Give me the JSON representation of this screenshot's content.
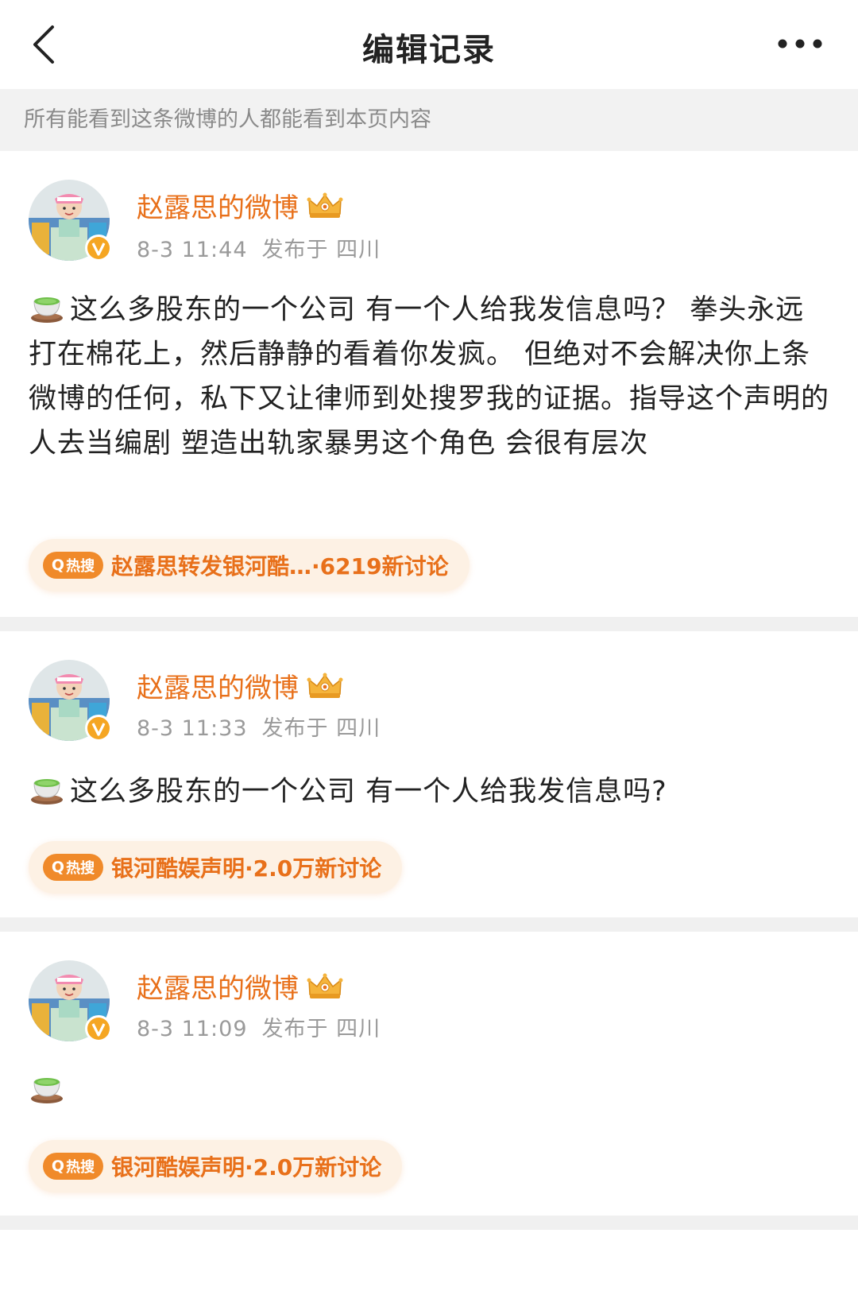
{
  "navbar": {
    "back_icon": "chevron-left-icon",
    "title": "编辑记录",
    "more_icon": "more-horizontal-icon"
  },
  "notice": "所有能看到这条微博的人都能看到本页内容",
  "accent_color": "#e8701a",
  "entries": [
    {
      "username": "赵露思的微博",
      "time": "8-3 11:44",
      "location": "发布于 四川",
      "emoji": "tea-icon",
      "text": "这么多股东的一个公司 有一个人给我发信息吗？ 拳头永远打在棉花上，然后静静的看着你发疯。 但绝对不会解决你上条微博的任何，私下又让律师到处搜罗我的证据。指导这个声明的人去当编剧 塑造出轨家暴男这个角色 会很有层次",
      "hot_badge": "热搜",
      "hot_topic": "赵露思转发银河酷…",
      "hot_count": " ·6219新讨论"
    },
    {
      "username": "赵露思的微博",
      "time": "8-3 11:33",
      "location": "发布于 四川",
      "emoji": "tea-icon",
      "text": "这么多股东的一个公司 有一个人给我发信息吗?",
      "hot_badge": "热搜",
      "hot_topic": "银河酷娱声明",
      "hot_count": "·2.0万新讨论"
    },
    {
      "username": "赵露思的微博",
      "time": "8-3 11:09",
      "location": "发布于 四川",
      "emoji": "tea-icon",
      "text": "",
      "hot_badge": "热搜",
      "hot_topic": "银河酷娱声明",
      "hot_count": "·2.0万新讨论"
    }
  ]
}
